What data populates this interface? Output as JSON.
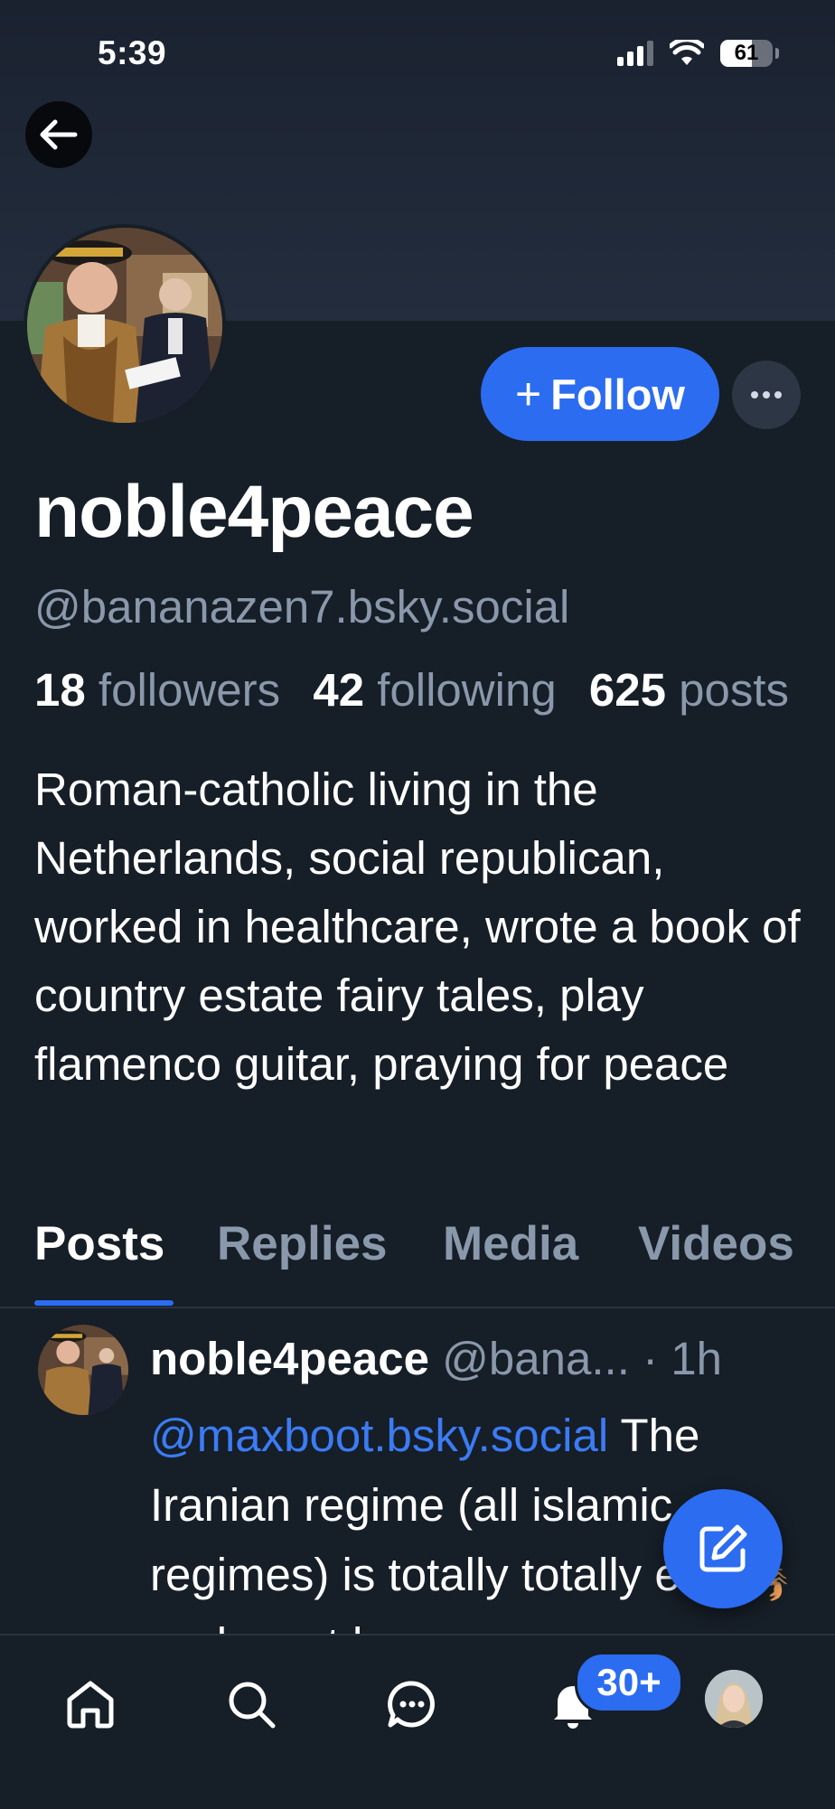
{
  "status_bar": {
    "time": "5:39",
    "battery": "61",
    "battery_percent": 61
  },
  "profile": {
    "display_name": "noble4peace",
    "handle": "@bananazen7.bsky.social",
    "follow_label": "+ Follow",
    "follow_text": "Follow",
    "follow_plus": "+",
    "more_label": "···",
    "stats": {
      "followers_count": "18",
      "followers_label": "followers",
      "following_count": "42",
      "following_label": "following",
      "posts_count": "625",
      "posts_label": "posts"
    },
    "bio": "Roman-catholic living in the Netherlands, social republican, worked in healthcare, wrote a book of country estate fairy tales, play flamenco guitar, praying for peace"
  },
  "tabs": [
    {
      "label": "Posts",
      "active": true
    },
    {
      "label": "Replies",
      "active": false
    },
    {
      "label": "Media",
      "active": false
    },
    {
      "label": "Videos",
      "active": false
    }
  ],
  "post": {
    "author": "noble4peace",
    "handle": "@bana...",
    "time": "· 1h",
    "mention": "@maxboot.bsky.social",
    "text": "The Iranian regime (all islamic regimes) is totally totally evil 🦂 and must be"
  },
  "bottom_nav": {
    "items": [
      "home-icon",
      "search-icon",
      "chat-icon",
      "bell-icon",
      "avatar"
    ],
    "notification_badge": "30+"
  },
  "colors": {
    "background": "#161e27",
    "accent": "#2b6cf1",
    "muted_text": "#8a98ab",
    "mention": "#3b7cf5"
  }
}
